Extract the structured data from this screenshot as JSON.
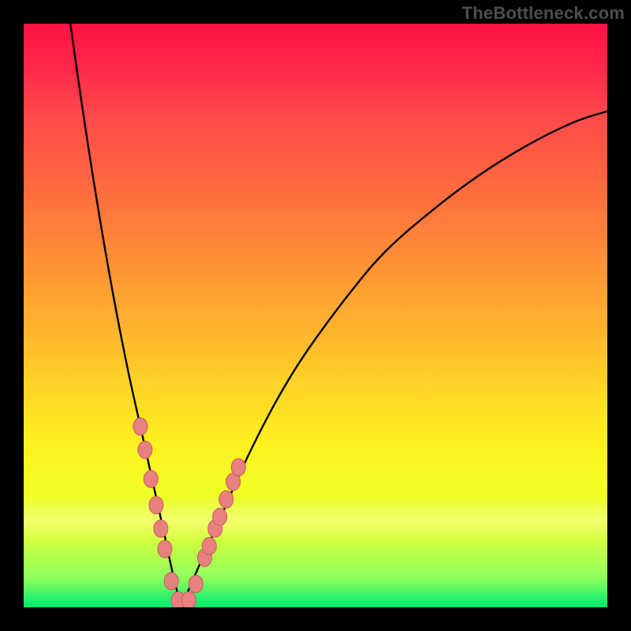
{
  "watermark": "TheBottleneck.com",
  "colors": {
    "frame": "#000000",
    "curve": "#000000",
    "marker_fill": "#e98080",
    "marker_stroke": "#c55b5b",
    "gradient_top": "#ff1245",
    "gradient_bottom": "#00e96f"
  },
  "chart_data": {
    "type": "line",
    "title": "",
    "xlabel": "",
    "ylabel": "",
    "xlim": [
      0,
      100
    ],
    "ylim": [
      0,
      100
    ],
    "note": "Axes have no tick labels in the image; x and y are in percent of the visible plot area, read bottom-left origin. Two curve segments form a V meeting near x≈27.",
    "series": [
      {
        "name": "left-branch",
        "x": [
          8,
          10,
          12,
          14,
          16,
          18,
          20,
          22,
          24,
          25.5,
          27
        ],
        "y": [
          100,
          86,
          73,
          61,
          50,
          40,
          31,
          22,
          13,
          6,
          0
        ]
      },
      {
        "name": "right-branch",
        "x": [
          27,
          30,
          34,
          38,
          42,
          46,
          50,
          56,
          62,
          70,
          78,
          86,
          94,
          100
        ],
        "y": [
          0,
          7,
          16,
          25,
          33,
          40,
          46,
          54,
          61,
          68,
          74,
          79,
          83,
          85
        ]
      }
    ],
    "markers": {
      "name": "highlighted-points",
      "x": [
        20.0,
        20.8,
        21.8,
        22.7,
        23.5,
        24.2,
        25.3,
        26.5,
        28.3,
        29.5,
        31.0,
        31.8,
        32.8,
        33.6,
        34.7,
        35.9,
        36.8
      ],
      "y": [
        31.0,
        27.0,
        22.0,
        17.5,
        13.5,
        10.0,
        4.5,
        1.2,
        1.2,
        4.0,
        8.5,
        10.5,
        13.5,
        15.5,
        18.5,
        21.5,
        24.0
      ]
    }
  }
}
